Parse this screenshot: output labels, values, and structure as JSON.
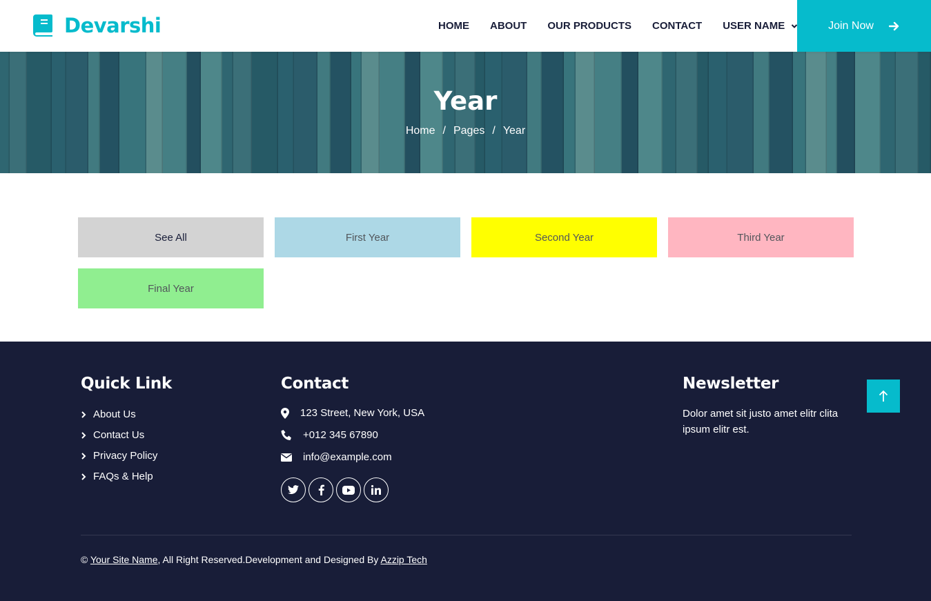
{
  "brand": {
    "name": "Devarshi",
    "icon": "book-icon",
    "color": "#06bbcc"
  },
  "nav": {
    "items": [
      {
        "label": "HOME"
      },
      {
        "label": "ABOUT"
      },
      {
        "label": "OUR PRODUCTS"
      },
      {
        "label": "CONTACT"
      },
      {
        "label": "USER NAME",
        "icon": "chevron-down-icon"
      }
    ],
    "join_label": "Join Now",
    "join_icon": "arrow-right-icon"
  },
  "hero": {
    "title": "Year",
    "breadcrumb": [
      "Home",
      "Pages",
      "Year"
    ],
    "separator": "/"
  },
  "filters": [
    {
      "label": "See All",
      "color": "#d3d3d3"
    },
    {
      "label": "First Year",
      "color": "#add8e6"
    },
    {
      "label": "Second Year",
      "color": "#ffff00"
    },
    {
      "label": "Third Year",
      "color": "#ffb6c1"
    },
    {
      "label": "Final Year",
      "color": "#90ee90"
    }
  ],
  "footer": {
    "quick_link": {
      "title": "Quick Link",
      "items": [
        "About Us",
        "Contact Us",
        "Privacy Policy",
        "FAQs & Help"
      ]
    },
    "contact": {
      "title": "Contact",
      "address": "123 Street, New York, USA",
      "phone": "+012 345 67890",
      "email": "info@example.com",
      "socials": [
        "twitter-icon",
        "facebook-icon",
        "youtube-icon",
        "linkedin-icon"
      ]
    },
    "newsletter": {
      "title": "Newsletter",
      "text": "Dolor amet sit justo amet elitr clita ipsum elitr est."
    },
    "copyright": {
      "symbol": "©",
      "site_name": "Your Site Name",
      "middle": ", All Right Reserved.Development and Designed By",
      "designer": "Azzip Tech"
    },
    "back_to_top_icon": "arrow-up-icon"
  }
}
